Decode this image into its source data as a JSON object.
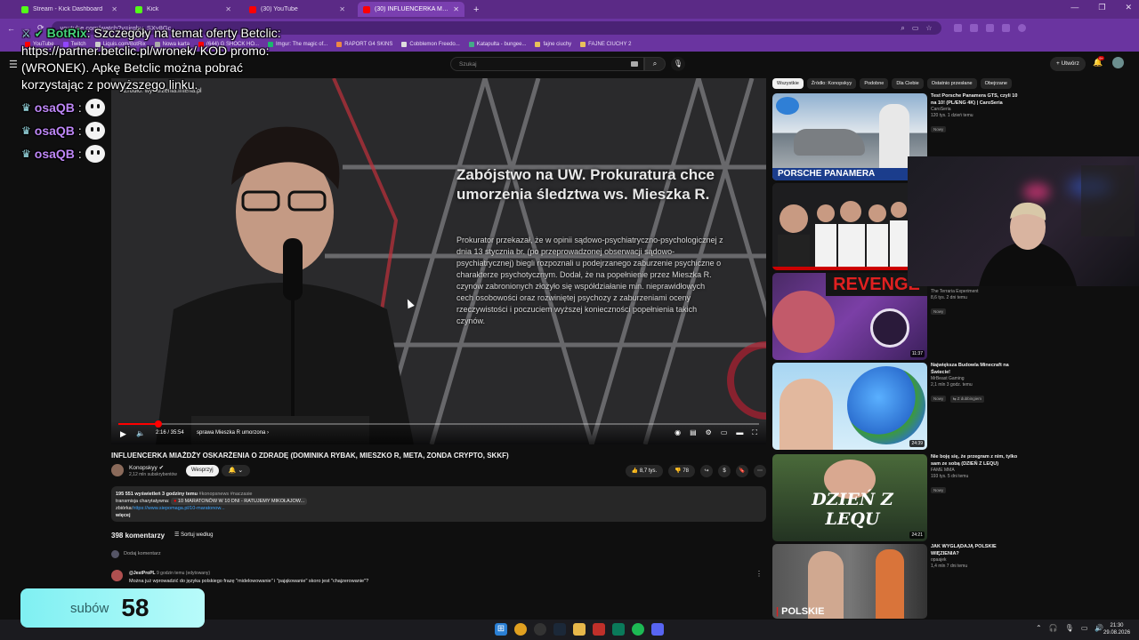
{
  "browser": {
    "tabs": [
      {
        "label": "Stream - Kick Dashboard",
        "color": "#53fc18"
      },
      {
        "label": "Kick",
        "color": "#53fc18"
      },
      {
        "label": "(30) YouTube",
        "color": "#ff0000"
      },
      {
        "label": "(30) INFLUENCERKA MIAŻD",
        "color": "#ff0000"
      }
    ],
    "url": "youtube.com/watch?v=jrghv_SXv8Gc",
    "bookmarks": [
      "YouTube",
      "Twitch",
      "Liquis.com/BotRix",
      "Nowa karta",
      "(644) G SHOCK HO...",
      "Imgur: The magic of...",
      "RAPORT G4 SKINS",
      "Cobblemon Freedo...",
      "Katapulta - bungee...",
      "fajne ciuchy",
      "FAJNE CIUCHY 2"
    ],
    "accent": "#6a34a0"
  },
  "youtube": {
    "search_placeholder": "Szukaj",
    "create_label": "Utwórz",
    "notif_count": "9+"
  },
  "chat": {
    "bot_name": "BotRix",
    "bot_message": ": Szczegóły na temat oferty Betclic: https://partner.betclic.pl/wronek/ KOD promo: (WRONEK). Apkę Betclic można pobrać korzystając z powyższego linku.",
    "lines": [
      {
        "user": "osaQB"
      },
      {
        "user": "osaQB"
      },
      {
        "user": "osaQB"
      }
    ]
  },
  "player": {
    "source_caption": "Źródło: wydarzenia.interia.pl",
    "headline": "Zabójstwo na UW. Prokuratura chce umorzenia śledztwa ws. Mieszka R.",
    "body": "Prokurator przekazał, że w opinii sądowo-psychiatryczno-psychologicznej z dnia 13 stycznia br. (po przeprowadzonej obserwacji sądowo-psychiatrycznej) biegli rozpoznali u podejrzanego zaburzenie psychiczne o charakterze psychotycznym. Dodał, że na popełnienie przez Mieszka R. czynów zabronionych złożyło się współdziałanie min. nieprawidłowych cech osobowości oraz rozwiniętej psychozy z zaburzeniami oceny rzeczywistości i poczuciem wyższej konieczności popełnienia takich czynów.",
    "time": "2:16 / 35:54",
    "chapter": "sprawa Mieszka R umorzona",
    "progress": 0.063
  },
  "video": {
    "title": "INFLUENCERKA MIAŻDŻY OSKARŻENIA O ZDRADĘ (DOMINIKA RYBAK, MIESZKO R, META, ZONDA CRYPTO, SKKF)",
    "channel": "Konopskyy",
    "subs": "2,12 mln subskrybentów",
    "support_label": "Wesprzyj",
    "likes": "8,7 tys.",
    "dislikes": "78"
  },
  "description": {
    "stats": "195 551 wyświetleń  3 godziny temu",
    "tags": "#konopsnews #naczasie",
    "line2_prefix": "transmisja charytatywna:",
    "line2_promo": "10 MARATONÓW W 10 DNI - RATUJEMY MIKOŁAJOW...",
    "line3_prefix": "zbiórka:",
    "line3_link": "https://www.siepomaga.pl/10-maratonow...",
    "more": "więcej"
  },
  "comments": {
    "count_label": "398 komentarzy",
    "sort_label": "Sortuj według",
    "add_placeholder": "Dodaj komentarz",
    "items": [
      {
        "author": "@JestProPL",
        "when": "9 godzin temu (edytowany)",
        "text": "Można już wprowadzić do języka polskiego frazę \"midelowowanie\" i \"pająkowanie\" skoro jest \"chajzerowanie\"?"
      }
    ]
  },
  "filters": [
    "Wszystkie",
    "Źródło: Konopskyy",
    "Podobne",
    "Dla Ciebie",
    "Ostatnio przesłane",
    "Obejrzane"
  ],
  "recommendations": [
    {
      "title": "Test Porsche Panamera GTS, czyli 10 na 10! (PL/ENG 4K) | CaroSeria",
      "channel": "CaroSeria",
      "stats": "120 tys.  1 dzień temu",
      "badge": "Nowy",
      "duration": "",
      "thumb_text": "PORSCHE PANAMERA"
    },
    {
      "title": "",
      "channel": "",
      "stats": "",
      "badge": "",
      "duration": "",
      "thumb_text": ""
    },
    {
      "title": "",
      "channel": "The Terraria Experiment",
      "stats": "8,6 tys.  2 dni temu",
      "badge": "Nowy",
      "duration": "11:37",
      "thumb_text": "REVENGE"
    },
    {
      "title": "Największa Budowla Minecraft na Świecie!",
      "channel": "MrBeast Gaming",
      "stats": "2,1 mln  3 godz. temu",
      "badge": "Nowy",
      "badge2": "Z dubbingiem",
      "duration": "24:39",
      "thumb_text": ""
    },
    {
      "title": "Nie boję się, że przegram z nim, tylko sam ze sobą (DZIEŃ Z LEQU)",
      "channel": "FAME MMA",
      "stats": "193 tys.  5 dni temu",
      "badge": "Nowy",
      "duration": "24:21",
      "thumb_text": "DZIEŃ Z LEQU"
    },
    {
      "title": "JAK WYGLĄDAJĄ POLSKIE WIĘZIENIA?",
      "channel": "opaajek",
      "stats": "1,4 mln  7 dni temu",
      "badge": "",
      "duration": "",
      "thumb_text": "POLSKIE"
    }
  ],
  "sub_counter": {
    "label": "subów",
    "value": "58"
  },
  "taskbar": {
    "time": "21:30",
    "date": "29.08.2026"
  }
}
